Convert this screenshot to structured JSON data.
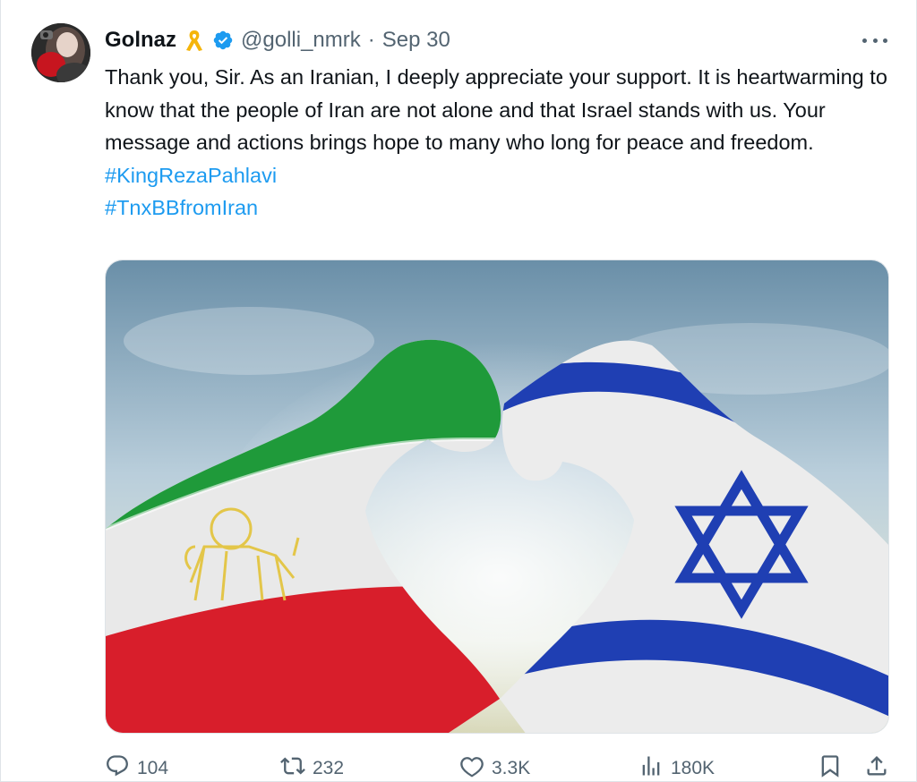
{
  "tweet": {
    "author_name": "Golnaz",
    "handle": "@golli_nmrk",
    "separator": "·",
    "date": "Sep 30",
    "text": "Thank you, Sir. As an Iranian, I deeply appreciate your support. It is heartwarming to know that the people of Iran are not alone and that Israel stands with us. Your message and actions brings hope to many who long for peace and freedom.",
    "hashtags": [
      "#KingRezaPahlavi",
      "#TnxBBfromIran"
    ],
    "media": {
      "alt": "",
      "flags": [
        "Iran (Lion and Sun)",
        "Israel"
      ]
    },
    "icons": {
      "ribbon": "yellow-ribbon-icon",
      "verified": "verified-badge-icon",
      "more": "more-options-icon",
      "reply": "reply-icon",
      "retweet": "retweet-icon",
      "like": "like-icon",
      "views": "views-icon",
      "bookmark": "bookmark-icon",
      "share": "share-icon"
    }
  },
  "actions": {
    "replies": "104",
    "retweets": "232",
    "likes": "3.3K",
    "views": "180K"
  },
  "colors": {
    "link": "#1d9bf0",
    "verified": "#1d9bf0",
    "ribbon": "#f5b50b",
    "secondary_text": "#536471"
  }
}
